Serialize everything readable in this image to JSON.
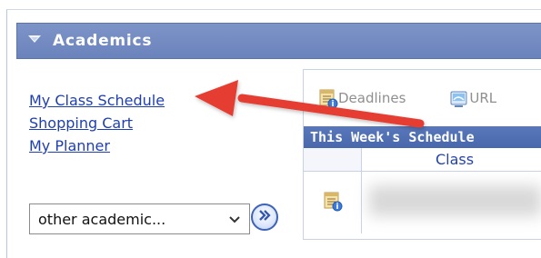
{
  "pagelet": {
    "title": "Academics"
  },
  "links": {
    "items": [
      {
        "label": "My Class Schedule"
      },
      {
        "label": "Shopping Cart"
      },
      {
        "label": "My Planner"
      }
    ]
  },
  "academic_select": {
    "value": "other academic..."
  },
  "schedule": {
    "deadlines_label": "Deadlines",
    "url_label": "URL",
    "header": "This Week's Schedule",
    "class_header": "Class"
  },
  "icons": {
    "collapse": "collapse-triangle-icon",
    "go": "double-chevron-right-icon",
    "calendar_info": "calendar-info-icon",
    "url": "url-icon"
  },
  "colors": {
    "pagelet_header": "#7388c1",
    "link": "#1f3fb1",
    "schedule_header": "#5472b6",
    "arrow": "#e53d31"
  }
}
